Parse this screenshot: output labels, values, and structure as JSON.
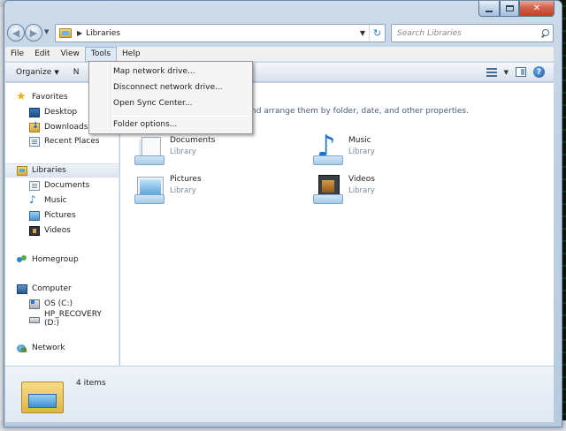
{
  "address": {
    "crumb": "Libraries",
    "search_placeholder": "Search Libraries"
  },
  "menu": {
    "items": [
      "File",
      "Edit",
      "View",
      "Tools",
      "Help"
    ],
    "active": "Tools"
  },
  "tools_menu": {
    "items": [
      "Map network drive...",
      "Disconnect network drive...",
      "Open Sync Center...",
      "Folder options..."
    ]
  },
  "command_bar": {
    "organize": "Organize",
    "new_partial": "N"
  },
  "nav": {
    "favorites": "Favorites",
    "desktop": "Desktop",
    "downloads": "Downloads",
    "recent_places": "Recent Places",
    "libraries": "Libraries",
    "documents": "Documents",
    "music": "Music",
    "pictures": "Pictures",
    "videos": "Videos",
    "homegroup": "Homegroup",
    "computer": "Computer",
    "os_drive": "OS (C:)",
    "hp_drive": "HP_RECOVERY (D:)",
    "network": "Network"
  },
  "content": {
    "header_text": "nd arrange them by folder, date, and other properties.",
    "libraries": [
      {
        "name": "Documents",
        "type": "Library"
      },
      {
        "name": "Music",
        "type": "Library"
      },
      {
        "name": "Pictures",
        "type": "Library"
      },
      {
        "name": "Videos",
        "type": "Library"
      }
    ]
  },
  "details": {
    "count": "4 items"
  },
  "colors": {
    "selection": "#dce6f1",
    "menu_highlight": "#dfe9f5",
    "link_blue": "#1f74c9"
  }
}
